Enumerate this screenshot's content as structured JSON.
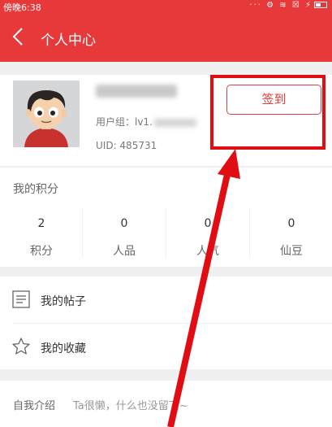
{
  "status_bar": {
    "time": "傍晚6:38",
    "icons": "··· ⚙ ≋ ☒ ⚡"
  },
  "header": {
    "title": "个人中心"
  },
  "profile": {
    "group_label": "用户组：lv1.",
    "uid": "UID: 485731",
    "signin_label": "签到"
  },
  "points": {
    "title": "我的积分",
    "stats": [
      {
        "value": "2",
        "label": "积分"
      },
      {
        "value": "0",
        "label": "人品"
      },
      {
        "value": "0",
        "label": "人气"
      },
      {
        "value": "0",
        "label": "仙豆"
      }
    ]
  },
  "menu": {
    "items": [
      {
        "label": "我的帖子",
        "icon": "document-icon"
      },
      {
        "label": "我的收藏",
        "icon": "star-icon"
      }
    ]
  },
  "intro": {
    "label": "自我介绍",
    "text": "Ta很懒，什么也没留下~"
  },
  "colors": {
    "accent": "#e8393a",
    "annotation": "#e00e12"
  }
}
